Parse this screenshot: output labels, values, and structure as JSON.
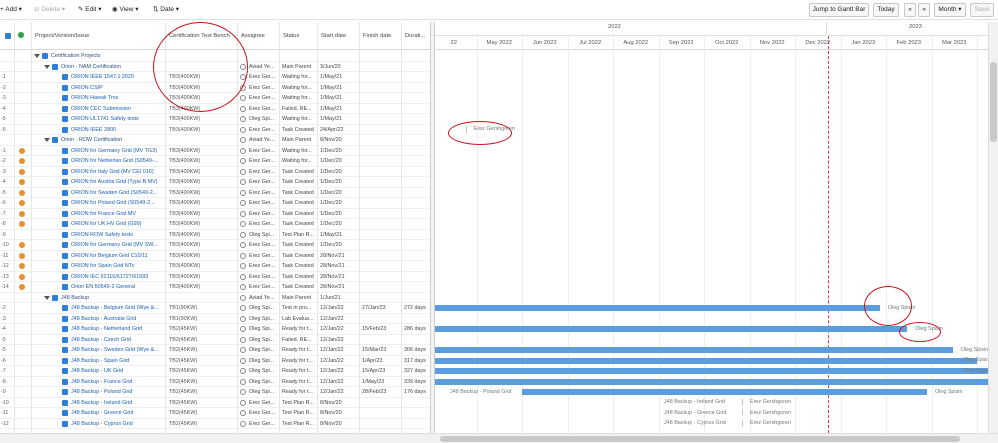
{
  "toolbar": {
    "add": "Add",
    "delete": "Delete",
    "edit": "Edit",
    "view": "View",
    "date": "Date",
    "jump": "Jump to Gantt Bar",
    "today": "Today",
    "prev": "«",
    "next": "»",
    "month": "Month",
    "save": "Save"
  },
  "columns": {
    "project": "Project/Version/Issue",
    "bench": "Certification Test Bench",
    "assignee": "Assignee",
    "status": "Status",
    "start": "Start date",
    "finish": "Finish date",
    "duration": "Durati..."
  },
  "timeline": {
    "years": [
      "2022",
      "2023"
    ],
    "months": [
      "22",
      "May 2022",
      "Jun 2022",
      "Jul 2022",
      "Aug 2022",
      "Sep 2022",
      "Oct 2022",
      "Nov 2022",
      "Dec 2022",
      "Jan 2023",
      "Feb 2023",
      "Mar 2023",
      "Apr 2023"
    ]
  },
  "rows": [
    {
      "id": "",
      "name": "Certification Projects",
      "bench": "",
      "assignee": "",
      "status": "",
      "start": "",
      "finish": "",
      "duration": "",
      "level": 0,
      "group": true,
      "warn": false
    },
    {
      "id": "",
      "name": "Orion - NAM Certification",
      "bench": "",
      "assignee": "Aviad Ye...",
      "status": "Main Parent",
      "start": "3/Jun/20",
      "finish": "",
      "duration": "",
      "level": 1,
      "group": true,
      "warn": false
    },
    {
      "id": "-1",
      "name": "ORION IEEE 1547.1 2020",
      "bench": "TB3(400KW)",
      "assignee": "Erez Ger...",
      "status": "Waiting for...",
      "start": "1/May/21",
      "finish": "",
      "duration": "",
      "level": 2,
      "group": false,
      "warn": false
    },
    {
      "id": "-2",
      "name": "ORION CSIP",
      "bench": "TB3(400KW)",
      "assignee": "Erez Ger...",
      "status": "Waiting for...",
      "start": "1/May/21",
      "finish": "",
      "duration": "",
      "level": 2,
      "group": false,
      "warn": false
    },
    {
      "id": "-3",
      "name": "ORION Hawaii Trox",
      "bench": "TB3(400KW)",
      "assignee": "Erez Ger...",
      "status": "Waiting for...",
      "start": "1/May/21",
      "finish": "",
      "duration": "",
      "level": 2,
      "group": false,
      "warn": false
    },
    {
      "id": "-4",
      "name": "ORION CEC Submission",
      "bench": "TB3(400KW)",
      "assignee": "Erez Ger...",
      "status": "Failed, RE...",
      "start": "1/May/21",
      "finish": "",
      "duration": "",
      "level": 2,
      "group": false,
      "warn": false
    },
    {
      "id": "-5",
      "name": "ORION UL1741 Safety tests",
      "bench": "TB3(400KW)",
      "assignee": "Oleg Spi...",
      "status": "Waiting for...",
      "start": "1/May/21",
      "finish": "",
      "duration": "",
      "level": 2,
      "group": false,
      "warn": false
    },
    {
      "id": "-6",
      "name": "ORION IEEE 2800",
      "bench": "TB3(400KW)",
      "assignee": "Erez Ger...",
      "status": "Task Created",
      "start": "24/Apr/22",
      "finish": "",
      "duration": "",
      "level": 2,
      "group": false,
      "warn": false
    },
    {
      "id": "",
      "name": "Orion - ROW Certification",
      "bench": "",
      "assignee": "Aviad Ye...",
      "status": "Main Parent",
      "start": "8/Nov/20",
      "finish": "",
      "duration": "",
      "level": 1,
      "group": true,
      "warn": false
    },
    {
      "id": "-1",
      "name": "ORION for Germany Grid (MV TG3)",
      "bench": "TB3(400KW)",
      "assignee": "Erez Ger...",
      "status": "Waiting for...",
      "start": "1/Dec/20",
      "finish": "",
      "duration": "",
      "level": 2,
      "group": false,
      "warn": true
    },
    {
      "id": "-2",
      "name": "ORION for Netherlan Grid (S0549-...",
      "bench": "TB3(400KW)",
      "assignee": "Erez Ger...",
      "status": "Waiting for...",
      "start": "1/Dec/20",
      "finish": "",
      "duration": "",
      "level": 2,
      "group": false,
      "warn": true
    },
    {
      "id": "-3",
      "name": "ORION for Italy Grid (MV CEI 016)",
      "bench": "TB3(400KW)",
      "assignee": "Erez Ger...",
      "status": "Task Created",
      "start": "1/Dec/20",
      "finish": "",
      "duration": "",
      "level": 2,
      "group": false,
      "warn": true
    },
    {
      "id": "-4",
      "name": "ORION for Austria Grid (Type B MV)",
      "bench": "TB3(400KW)",
      "assignee": "Erez Ger...",
      "status": "Task Created",
      "start": "1/Dec/20",
      "finish": "",
      "duration": "",
      "level": 2,
      "group": false,
      "warn": true
    },
    {
      "id": "-5",
      "name": "ORION for Sweden Grid (S0549-2...",
      "bench": "TB3(400KW)",
      "assignee": "Erez Ger...",
      "status": "Task Created",
      "start": "1/Dec/20",
      "finish": "",
      "duration": "",
      "level": 2,
      "group": false,
      "warn": true
    },
    {
      "id": "-6",
      "name": "ORION for Poland Grid (S0549-2...",
      "bench": "TB3(400KW)",
      "assignee": "Erez Ger...",
      "status": "Task Created",
      "start": "1/Dec/20",
      "finish": "",
      "duration": "",
      "level": 2,
      "group": false,
      "warn": true
    },
    {
      "id": "-7",
      "name": "ORION for France Grid MV",
      "bench": "TB3(400KW)",
      "assignee": "Erez Ger...",
      "status": "Task Created",
      "start": "1/Dec/20",
      "finish": "",
      "duration": "",
      "level": 2,
      "group": false,
      "warn": true
    },
    {
      "id": "-8",
      "name": "ORION for UK HV Grid (G99)",
      "bench": "TB3(400KW)",
      "assignee": "Erez Ger...",
      "status": "Task Created",
      "start": "1/Dec/20",
      "finish": "",
      "duration": "",
      "level": 2,
      "group": false,
      "warn": true
    },
    {
      "id": "-9",
      "name": "ORION ROW Safety tests",
      "bench": "TB3(400KW)",
      "assignee": "Oleg Spi...",
      "status": "Test Plan R...",
      "start": "1/May/21",
      "finish": "",
      "duration": "",
      "level": 2,
      "group": false,
      "warn": false
    },
    {
      "id": "-10",
      "name": "ORION for Germany Grid (MV SW...",
      "bench": "TB3(400KW)",
      "assignee": "Erez Ger...",
      "status": "Task Created",
      "start": "1/Dec/20",
      "finish": "",
      "duration": "",
      "level": 2,
      "group": false,
      "warn": true
    },
    {
      "id": "-11",
      "name": "ORION for Belgium Grid C10/11",
      "bench": "TB3(400KW)",
      "assignee": "Erez Ger...",
      "status": "Task Created",
      "start": "28/Nov/21",
      "finish": "",
      "duration": "",
      "level": 2,
      "group": false,
      "warn": true
    },
    {
      "id": "-12",
      "name": "ORION for Spain Grid NTs",
      "bench": "TB3(400KW)",
      "assignee": "Erez Ger...",
      "status": "Task Created",
      "start": "28/Nov/21",
      "finish": "",
      "duration": "",
      "level": 2,
      "group": false,
      "warn": true
    },
    {
      "id": "-13",
      "name": "ORION IEC 62116/61727/61683",
      "bench": "TB3(400KW)",
      "assignee": "Erez Ger...",
      "status": "Task Created",
      "start": "28/Nov/21",
      "finish": "",
      "duration": "",
      "level": 2,
      "group": false,
      "warn": true
    },
    {
      "id": "-14",
      "name": "Orion EN 50549-2 General",
      "bench": "TB3(400KW)",
      "assignee": "Erez Ger...",
      "status": "Task Created",
      "start": "28/Nov/21",
      "finish": "",
      "duration": "",
      "level": 2,
      "group": false,
      "warn": true
    },
    {
      "id": "",
      "name": "J48 Backup",
      "bench": "",
      "assignee": "Aviad Ye...",
      "status": "Main Parent",
      "start": "1/Jun/21",
      "finish": "",
      "duration": "",
      "level": 1,
      "group": true,
      "warn": false
    },
    {
      "id": "-2",
      "name": "J48 Backup - Belgium Grid (Wye &...",
      "bench": "TB1(90KW)",
      "assignee": "Oleg Spi...",
      "status": "Test in pro...",
      "start": "12/Jan/22",
      "finish": "27/Jan/23",
      "duration": "272 days",
      "level": 2,
      "group": false,
      "warn": false
    },
    {
      "id": "-3",
      "name": "J48 Backup - Australia Grid",
      "bench": "TB1(90KW)",
      "assignee": "Oleg Spi...",
      "status": "Lab Evalua...",
      "start": "12/Jan/22",
      "finish": "",
      "duration": "",
      "level": 2,
      "group": false,
      "warn": false
    },
    {
      "id": "-4",
      "name": "J48 Backup - Netherland Grid",
      "bench": "TB2(45KW)",
      "assignee": "Oleg Spi...",
      "status": "Ready for t...",
      "start": "12/Jan/22",
      "finish": "15/Feb/23",
      "duration": "286 days",
      "level": 2,
      "group": false,
      "warn": false
    },
    {
      "id": "-5",
      "name": "J48 Backup - Czech Grid",
      "bench": "TB2(45KW)",
      "assignee": "Oleg Spi...",
      "status": "Failed, RE...",
      "start": "12/Jan/22",
      "finish": "",
      "duration": "",
      "level": 2,
      "group": false,
      "warn": false
    },
    {
      "id": "-5",
      "name": "J48 Backup - Sweden Grid (Wye &...",
      "bench": "TB2(45KW)",
      "assignee": "Oleg Spi...",
      "status": "Ready for t...",
      "start": "12/Jan/22",
      "finish": "15/Mar/23",
      "duration": "306 days",
      "level": 2,
      "group": false,
      "warn": false
    },
    {
      "id": "-6",
      "name": "J48 Backup - Spain Grid",
      "bench": "TB2(45KW)",
      "assignee": "Oleg Spi...",
      "status": "Ready for t...",
      "start": "12/Jan/22",
      "finish": "1/Apr/23",
      "duration": "317 days",
      "level": 2,
      "group": false,
      "warn": false
    },
    {
      "id": "-7",
      "name": "J48 Backup - UK Grid",
      "bench": "TB2(45KW)",
      "assignee": "Oleg Spi...",
      "status": "Ready for t...",
      "start": "12/Jan/22",
      "finish": "15/Apr/23",
      "duration": "327 days",
      "level": 2,
      "group": false,
      "warn": false
    },
    {
      "id": "-8",
      "name": "J48 Backup - France Grid",
      "bench": "TB2(45KW)",
      "assignee": "Oleg Spi...",
      "status": "Ready for t...",
      "start": "12/Jan/22",
      "finish": "1/May/23",
      "duration": "339 days",
      "level": 2,
      "group": false,
      "warn": false
    },
    {
      "id": "-9",
      "name": "J48 Backup - Poland Grid",
      "bench": "TB2(45KW)",
      "assignee": "Oleg Spi...",
      "status": "Ready for t...",
      "start": "12/Jan/22",
      "finish": "28/Feb/23",
      "duration": "176 days",
      "level": 2,
      "group": false,
      "warn": false
    },
    {
      "id": "-10",
      "name": "J48 Backup - Ireland Grid",
      "bench": "TB2(45KW)",
      "assignee": "Erez Ger...",
      "status": "Test Plan R...",
      "start": "8/Nov/20",
      "finish": "",
      "duration": "",
      "level": 2,
      "group": false,
      "warn": false
    },
    {
      "id": "-11",
      "name": "J48 Backup - Greece Grid",
      "bench": "TB2(45KW)",
      "assignee": "Erez Ger...",
      "status": "Test Plan R...",
      "start": "8/Nov/20",
      "finish": "",
      "duration": "",
      "level": 2,
      "group": false,
      "warn": false
    },
    {
      "id": "-12",
      "name": "J48 Backup - Cyprus Grid",
      "bench": "TB2(45KW)",
      "assignee": "Erez Ger...",
      "status": "Test Plan R...",
      "start": "8/Nov/20",
      "finish": "",
      "duration": "",
      "level": 2,
      "group": false,
      "warn": false
    }
  ],
  "bars": [
    {
      "row": 24,
      "start": "12/Jan/22",
      "end": "27/Jan/23",
      "label": "Oleg Spisin",
      "kind": "bar"
    },
    {
      "row": 26,
      "start": "12/Jan/22",
      "end": "15/Feb/23",
      "label": "Oleg Spisin",
      "kind": "bar"
    },
    {
      "row": 28,
      "start": "12/Jan/22",
      "end": "15/Mar/23",
      "label": "Oleg Spisin",
      "kind": "bar"
    },
    {
      "row": 29,
      "start": "12/Jan/22",
      "end": "1/Apr/23",
      "label": "Oleg Spisin",
      "kind": "bar"
    },
    {
      "row": 30,
      "start": "12/Jan/22",
      "end": "15/Apr/23",
      "label": "Oleg Spisin",
      "kind": "bar"
    },
    {
      "row": 31,
      "start": "12/Jan/22",
      "end": "1/May/23",
      "label": "",
      "kind": "bar"
    },
    {
      "row": 32,
      "start": "1/Jun/22",
      "end": "28/Feb/23",
      "label": "Oleg Spisin",
      "kind": "bar",
      "prefix": "J48 Backup - Poland Grid"
    },
    {
      "row": 7,
      "start": "24/Apr/22",
      "end": "",
      "label": "Erez Gershgoren",
      "kind": "marker"
    },
    {
      "row": 33,
      "start": "",
      "end": "",
      "label": "Erez Gershgoren",
      "kind": "marker",
      "prefix": "J48 Backup - Ireland Grid"
    },
    {
      "row": 34,
      "start": "",
      "end": "",
      "label": "Erez Gershgoren",
      "kind": "marker",
      "prefix": "J48 Backup - Greece Grid"
    },
    {
      "row": 35,
      "start": "",
      "end": "",
      "label": "Erez Gershgoren",
      "kind": "marker",
      "prefix": "J48 Backup - Cyprus Grid"
    }
  ]
}
